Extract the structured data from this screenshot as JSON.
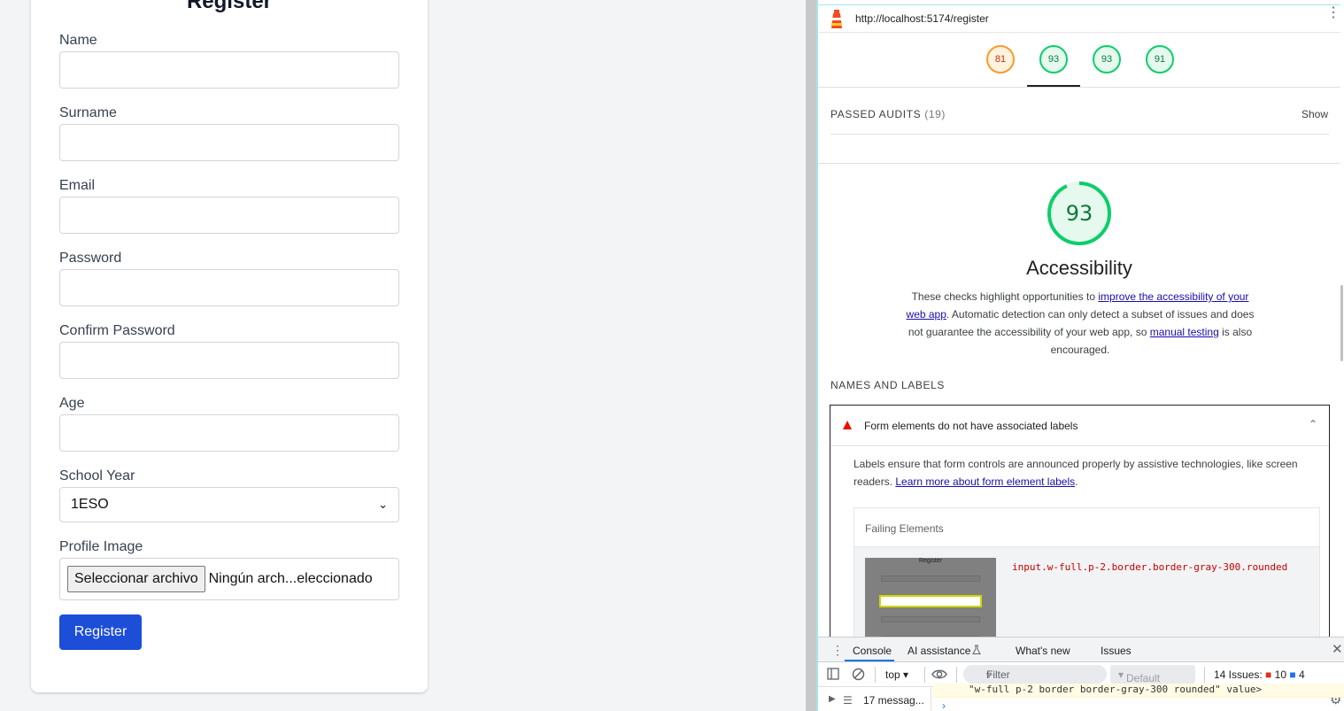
{
  "form": {
    "title": "Register",
    "fields": [
      {
        "label": "Name",
        "value": ""
      },
      {
        "label": "Surname",
        "value": ""
      },
      {
        "label": "Email",
        "value": ""
      },
      {
        "label": "Password",
        "value": ""
      },
      {
        "label": "Confirm Password",
        "value": ""
      },
      {
        "label": "Age",
        "value": ""
      }
    ],
    "school_year": {
      "label": "School Year",
      "selected": "1ESO"
    },
    "profile_image": {
      "label": "Profile Image",
      "button": "Seleccionar archivo",
      "file_name": "Ningún arch...eleccionado"
    },
    "submit_label": "Register"
  },
  "lighthouse": {
    "url": "http://localhost:5174/register",
    "scores": [
      {
        "value": "81",
        "color": "#fa9a2c"
      },
      {
        "value": "93",
        "color": "#0cce6b"
      },
      {
        "value": "93",
        "color": "#0cce6b"
      },
      {
        "value": "91",
        "color": "#0cce6b"
      }
    ],
    "passed_audits": "PASSED AUDITS",
    "passed_count": "(19)",
    "show": "Show",
    "category": {
      "score": "93",
      "score_fraction": 0.93,
      "title": "Accessibility",
      "desc_1": "These checks highlight opportunities to ",
      "desc_link_1": "improve the accessibility of your web app",
      "desc_2": ". Automatic detection can only detect a subset of issues and does not guarantee the accessibility of your web app, so ",
      "desc_link_2": "manual testing",
      "desc_3": " is also encouraged."
    },
    "group_title": "NAMES AND LABELS",
    "audit": {
      "title": "Form elements do not have associated labels",
      "desc": "Labels ensure that form controls are announced properly by assistive technologies, like screen readers. ",
      "link": "Learn more about form element labels",
      "desc_end": ".",
      "failing_header": "Failing Elements",
      "thumbnail_title": "Register",
      "selector": "input.w-full.p-2.border.border-gray-300.rounded"
    }
  },
  "console": {
    "tabs": [
      "Console",
      "AI assistance",
      "What's new",
      "Issues"
    ],
    "context": "top",
    "filter_placeholder": "Filter",
    "levels": "Default levels",
    "issues_label": "14 Issues:",
    "issues_errors": "10",
    "issues_info": "4",
    "messages": "17 messag...",
    "log_line": "\"w-full p-2 border border-gray-300 rounded\" value>"
  }
}
